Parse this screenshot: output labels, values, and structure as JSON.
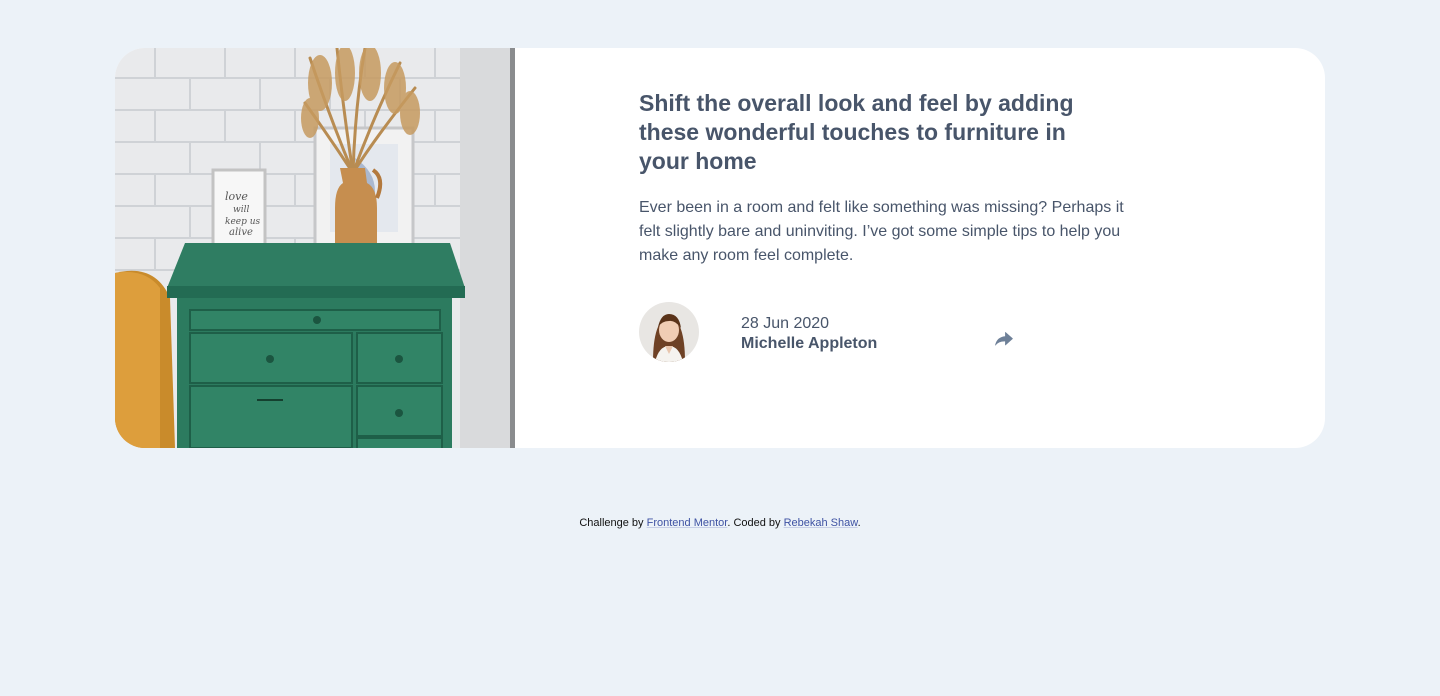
{
  "card": {
    "title": "Shift the overall look and feel by adding these wonderful touches to furniture in your home",
    "description": "Ever been in a room and felt like something was missing? Perhaps it felt slightly bare and uninviting. I’ve got some simple tips to help you make any room feel complete.",
    "date": "28 Jun 2020",
    "author": "Michelle Appleton",
    "image_icon": "drawers-photo",
    "avatar_icon": "avatar-photo",
    "share_icon": "share-icon"
  },
  "footer": {
    "challenge_by": "Challenge by",
    "frontend_mentor": "Frontend Mentor",
    "coded_by": ". Coded by",
    "author_link": "Rebekah Shaw",
    "end": "."
  },
  "colors": {
    "page_bg": "#ecf2f8",
    "card_bg": "#ffffff",
    "text": "#48556a",
    "share_icon": "#6e8098",
    "link": "#3e52a3"
  }
}
